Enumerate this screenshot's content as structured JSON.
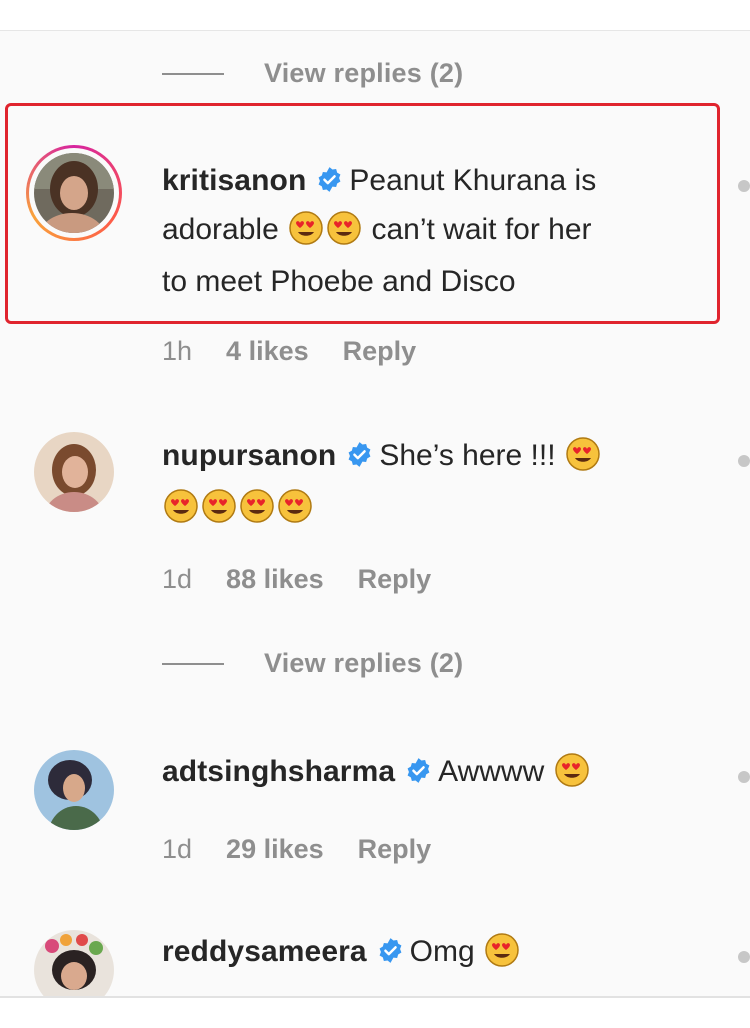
{
  "colors": {
    "highlight_border": "#e0242e",
    "secondary_text": "#8e8e8e",
    "verified_blue": "#3897f0"
  },
  "view_replies_1": {
    "label": "View replies (2)"
  },
  "view_replies_2": {
    "label": "View replies (2)"
  },
  "comments": [
    {
      "username": "kritisanon",
      "verified": true,
      "text_line1": "Peanut Khurana is",
      "text_line2_a": "adorable",
      "emoji_line2": 2,
      "text_line2_b": "can’t wait for her",
      "text_line3": "to meet Phoebe and Disco",
      "time": "1h",
      "likes": "4 likes",
      "reply": "Reply",
      "highlighted": true,
      "avatar_icon": "profile-photo"
    },
    {
      "username": "nupursanon",
      "verified": true,
      "text_line1": "She’s here !!!",
      "emoji_line1": 1,
      "emoji_line2": 4,
      "time": "1d",
      "likes": "88 likes",
      "reply": "Reply",
      "avatar_icon": "profile-photo"
    },
    {
      "username": "adtsinghsharma",
      "verified": true,
      "text_line1": "Awwww",
      "emoji_line1": 1,
      "time": "1d",
      "likes": "29 likes",
      "reply": "Reply",
      "avatar_icon": "profile-photo"
    },
    {
      "username": "reddysameera",
      "verified": true,
      "text_line1": "Omg",
      "emoji_line1": 1,
      "avatar_icon": "profile-photo"
    }
  ]
}
